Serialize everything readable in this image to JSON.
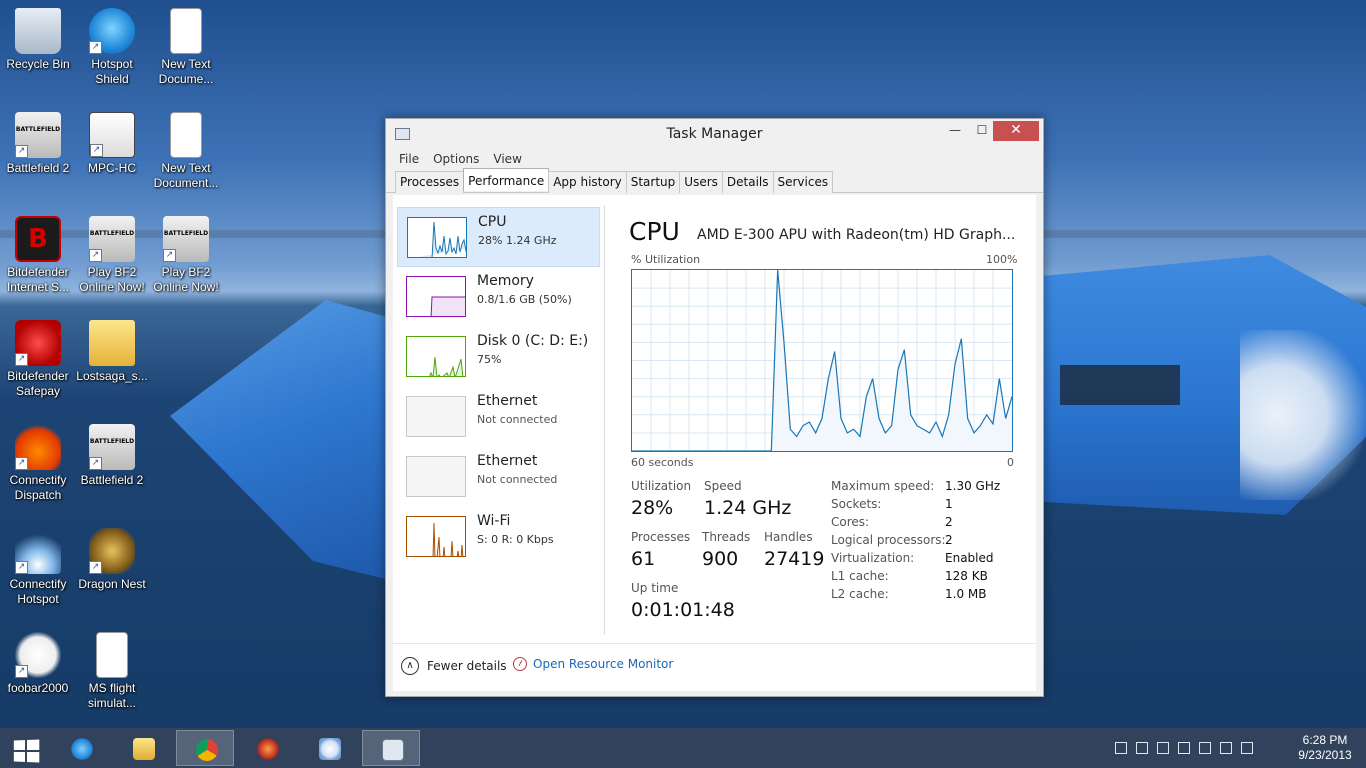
{
  "desktop": {
    "icons": [
      {
        "label": "Recycle Bin"
      },
      {
        "label": "Hotspot\nShield"
      },
      {
        "label": "New Text\nDocume..."
      },
      {
        "label": "Battlefield 2"
      },
      {
        "label": "MPC-HC"
      },
      {
        "label": "New Text\nDocument..."
      },
      {
        "label": "Bitdefender\nInternet S..."
      },
      {
        "label": "Play BF2\nOnline Now!"
      },
      {
        "label": "Play BF2\nOnline Now!"
      },
      {
        "label": "Bitdefender\nSafepay"
      },
      {
        "label": "Lostsaga_s..."
      },
      {
        "label": "Connectify\nDispatch"
      },
      {
        "label": "Battlefield 2"
      },
      {
        "label": "Connectify\nHotspot"
      },
      {
        "label": "Dragon Nest"
      },
      {
        "label": "foobar2000"
      },
      {
        "label": "MS flight\nsimulat..."
      }
    ]
  },
  "window": {
    "title": "Task Manager",
    "controls": {
      "minimize": "—",
      "maximize": "☐",
      "close": "✕"
    },
    "menu": [
      "File",
      "Options",
      "View"
    ],
    "tabs": [
      "Processes",
      "Performance",
      "App history",
      "Startup",
      "Users",
      "Details",
      "Services"
    ],
    "active_tab": "Performance"
  },
  "sidebar": {
    "items": [
      {
        "name": "CPU",
        "sub": "28%  1.24 GHz",
        "color": "#1a76b6"
      },
      {
        "name": "Memory",
        "sub": "0.8/1.6 GB (50%)",
        "color": "#8b12ae"
      },
      {
        "name": "Disk 0 (C: D: E:)",
        "sub": "75%",
        "color": "#4da60c"
      },
      {
        "name": "Ethernet",
        "sub": "Not connected",
        "color": "#c8c8c8"
      },
      {
        "name": "Ethernet",
        "sub": "Not connected",
        "color": "#c8c8c8"
      },
      {
        "name": "Wi-Fi",
        "sub": "S: 0  R: 0 Kbps",
        "color": "#a74f01"
      }
    ]
  },
  "main": {
    "title": "CPU",
    "model": "AMD E-300 APU with Radeon(tm) HD Graph...",
    "util_label": "% Utilization",
    "util_max": "100%",
    "time_left": "60 seconds",
    "time_right": "0",
    "stats": {
      "utilization_label": "Utilization",
      "utilization": "28%",
      "speed_label": "Speed",
      "speed": "1.24 GHz",
      "processes_label": "Processes",
      "processes": "61",
      "threads_label": "Threads",
      "threads": "900",
      "handles_label": "Handles",
      "handles": "27419",
      "uptime_label": "Up time",
      "uptime": "0:01:01:48"
    },
    "specs": [
      {
        "label": "Maximum speed:",
        "value": "1.30 GHz"
      },
      {
        "label": "Sockets:",
        "value": "1"
      },
      {
        "label": "Cores:",
        "value": "2"
      },
      {
        "label": "Logical processors:",
        "value": "2"
      },
      {
        "label": "Virtualization:",
        "value": "Enabled"
      },
      {
        "label": "L1 cache:",
        "value": "128 KB"
      },
      {
        "label": "L2 cache:",
        "value": "1.0 MB"
      }
    ],
    "graph_color": "#1a76b6",
    "cpu_history": [
      0,
      0,
      0,
      0,
      0,
      0,
      0,
      0,
      0,
      0,
      0,
      0,
      0,
      0,
      0,
      0,
      0,
      0,
      0,
      0,
      0,
      0,
      0,
      100,
      60,
      12,
      8,
      14,
      16,
      10,
      18,
      40,
      55,
      18,
      10,
      12,
      8,
      30,
      40,
      18,
      10,
      14,
      45,
      56,
      20,
      14,
      12,
      10,
      16,
      8,
      20,
      48,
      62,
      18,
      10,
      14,
      20,
      15,
      40,
      18,
      30
    ]
  },
  "footer": {
    "fewer_details": "Fewer details",
    "open_resource_monitor": "Open Resource Monitor"
  },
  "taskbar": {
    "time": "6:28 PM",
    "date": "9/23/2013"
  }
}
